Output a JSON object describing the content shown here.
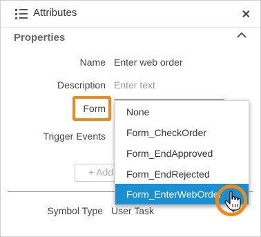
{
  "panel": {
    "title": "Attributes",
    "close_icon": "close-icon",
    "list_icon": "list-icon"
  },
  "section": {
    "title": "Properties",
    "collapse_icon": "chevron-up-icon"
  },
  "fields": {
    "name": {
      "label": "Name",
      "value": "Enter web order"
    },
    "description": {
      "label": "Description",
      "placeholder": "Enter text"
    },
    "form": {
      "label": "Form"
    },
    "trigger_events": {
      "label": "Trigger Events"
    },
    "add_button": {
      "label": "+ Add"
    },
    "symbol_type": {
      "label": "Symbol Type",
      "value": "User Task"
    }
  },
  "dropdown": {
    "options": [
      "None",
      "Form_CheckOrder",
      "Form_EndApproved",
      "Form_EndRejected",
      "Form_EnterWebOrder"
    ],
    "selected_index": 4
  },
  "colors": {
    "highlight": "#f08a16",
    "selected": "#1a8fd1"
  }
}
